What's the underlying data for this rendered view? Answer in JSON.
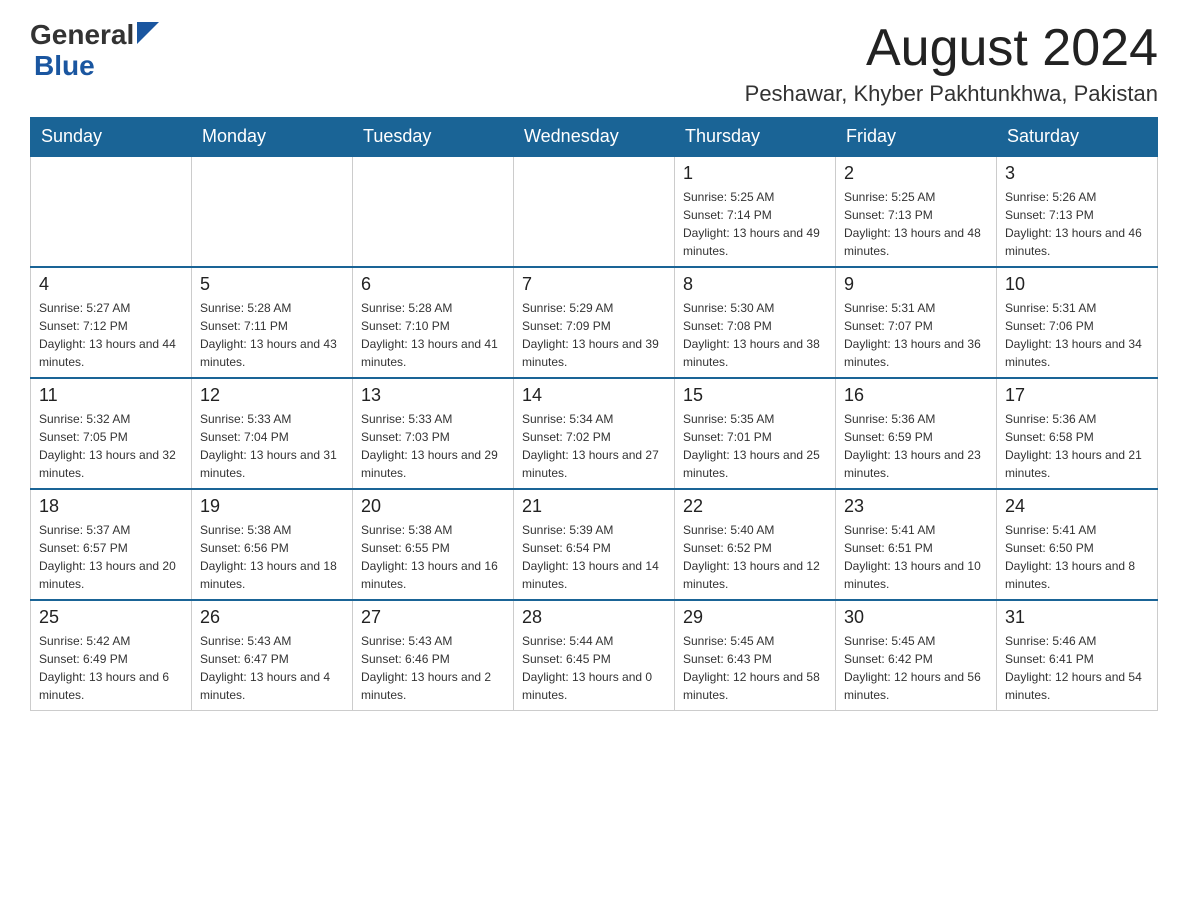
{
  "logo": {
    "general": "General",
    "blue": "Blue"
  },
  "header": {
    "month": "August 2024",
    "location": "Peshawar, Khyber Pakhtunkhwa, Pakistan"
  },
  "days_of_week": [
    "Sunday",
    "Monday",
    "Tuesday",
    "Wednesday",
    "Thursday",
    "Friday",
    "Saturday"
  ],
  "weeks": [
    [
      {
        "day": "",
        "info": ""
      },
      {
        "day": "",
        "info": ""
      },
      {
        "day": "",
        "info": ""
      },
      {
        "day": "",
        "info": ""
      },
      {
        "day": "1",
        "info": "Sunrise: 5:25 AM\nSunset: 7:14 PM\nDaylight: 13 hours and 49 minutes."
      },
      {
        "day": "2",
        "info": "Sunrise: 5:25 AM\nSunset: 7:13 PM\nDaylight: 13 hours and 48 minutes."
      },
      {
        "day": "3",
        "info": "Sunrise: 5:26 AM\nSunset: 7:13 PM\nDaylight: 13 hours and 46 minutes."
      }
    ],
    [
      {
        "day": "4",
        "info": "Sunrise: 5:27 AM\nSunset: 7:12 PM\nDaylight: 13 hours and 44 minutes."
      },
      {
        "day": "5",
        "info": "Sunrise: 5:28 AM\nSunset: 7:11 PM\nDaylight: 13 hours and 43 minutes."
      },
      {
        "day": "6",
        "info": "Sunrise: 5:28 AM\nSunset: 7:10 PM\nDaylight: 13 hours and 41 minutes."
      },
      {
        "day": "7",
        "info": "Sunrise: 5:29 AM\nSunset: 7:09 PM\nDaylight: 13 hours and 39 minutes."
      },
      {
        "day": "8",
        "info": "Sunrise: 5:30 AM\nSunset: 7:08 PM\nDaylight: 13 hours and 38 minutes."
      },
      {
        "day": "9",
        "info": "Sunrise: 5:31 AM\nSunset: 7:07 PM\nDaylight: 13 hours and 36 minutes."
      },
      {
        "day": "10",
        "info": "Sunrise: 5:31 AM\nSunset: 7:06 PM\nDaylight: 13 hours and 34 minutes."
      }
    ],
    [
      {
        "day": "11",
        "info": "Sunrise: 5:32 AM\nSunset: 7:05 PM\nDaylight: 13 hours and 32 minutes."
      },
      {
        "day": "12",
        "info": "Sunrise: 5:33 AM\nSunset: 7:04 PM\nDaylight: 13 hours and 31 minutes."
      },
      {
        "day": "13",
        "info": "Sunrise: 5:33 AM\nSunset: 7:03 PM\nDaylight: 13 hours and 29 minutes."
      },
      {
        "day": "14",
        "info": "Sunrise: 5:34 AM\nSunset: 7:02 PM\nDaylight: 13 hours and 27 minutes."
      },
      {
        "day": "15",
        "info": "Sunrise: 5:35 AM\nSunset: 7:01 PM\nDaylight: 13 hours and 25 minutes."
      },
      {
        "day": "16",
        "info": "Sunrise: 5:36 AM\nSunset: 6:59 PM\nDaylight: 13 hours and 23 minutes."
      },
      {
        "day": "17",
        "info": "Sunrise: 5:36 AM\nSunset: 6:58 PM\nDaylight: 13 hours and 21 minutes."
      }
    ],
    [
      {
        "day": "18",
        "info": "Sunrise: 5:37 AM\nSunset: 6:57 PM\nDaylight: 13 hours and 20 minutes."
      },
      {
        "day": "19",
        "info": "Sunrise: 5:38 AM\nSunset: 6:56 PM\nDaylight: 13 hours and 18 minutes."
      },
      {
        "day": "20",
        "info": "Sunrise: 5:38 AM\nSunset: 6:55 PM\nDaylight: 13 hours and 16 minutes."
      },
      {
        "day": "21",
        "info": "Sunrise: 5:39 AM\nSunset: 6:54 PM\nDaylight: 13 hours and 14 minutes."
      },
      {
        "day": "22",
        "info": "Sunrise: 5:40 AM\nSunset: 6:52 PM\nDaylight: 13 hours and 12 minutes."
      },
      {
        "day": "23",
        "info": "Sunrise: 5:41 AM\nSunset: 6:51 PM\nDaylight: 13 hours and 10 minutes."
      },
      {
        "day": "24",
        "info": "Sunrise: 5:41 AM\nSunset: 6:50 PM\nDaylight: 13 hours and 8 minutes."
      }
    ],
    [
      {
        "day": "25",
        "info": "Sunrise: 5:42 AM\nSunset: 6:49 PM\nDaylight: 13 hours and 6 minutes."
      },
      {
        "day": "26",
        "info": "Sunrise: 5:43 AM\nSunset: 6:47 PM\nDaylight: 13 hours and 4 minutes."
      },
      {
        "day": "27",
        "info": "Sunrise: 5:43 AM\nSunset: 6:46 PM\nDaylight: 13 hours and 2 minutes."
      },
      {
        "day": "28",
        "info": "Sunrise: 5:44 AM\nSunset: 6:45 PM\nDaylight: 13 hours and 0 minutes."
      },
      {
        "day": "29",
        "info": "Sunrise: 5:45 AM\nSunset: 6:43 PM\nDaylight: 12 hours and 58 minutes."
      },
      {
        "day": "30",
        "info": "Sunrise: 5:45 AM\nSunset: 6:42 PM\nDaylight: 12 hours and 56 minutes."
      },
      {
        "day": "31",
        "info": "Sunrise: 5:46 AM\nSunset: 6:41 PM\nDaylight: 12 hours and 54 minutes."
      }
    ]
  ]
}
